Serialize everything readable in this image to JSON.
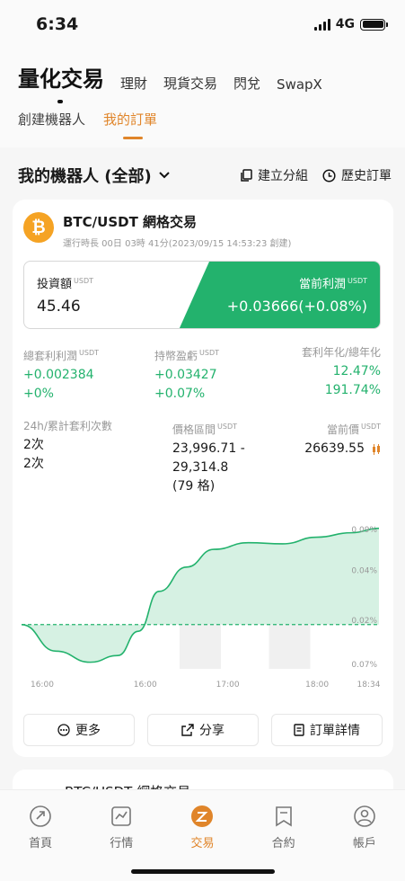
{
  "status": {
    "time": "6:34",
    "network": "4G"
  },
  "header": {
    "tabs": [
      "量化交易",
      "理財",
      "現貨交易",
      "閃兌",
      "SwapX"
    ],
    "sub_tabs": [
      "創建機器人",
      "我的訂單"
    ]
  },
  "section": {
    "title": "我的機器人 (全部)",
    "group_action": "建立分組",
    "history_action": "歷史訂單"
  },
  "bot": {
    "coin_icon": "bitcoin-icon",
    "pair": "BTC/USDT 網格交易",
    "runtime": "運行時長 00日 03時 41分(2023/09/15 14:53:23 創建)",
    "invest_label": "投資額",
    "invest_unit": "USDT",
    "invest_value": "45.46",
    "profit_label": "當前利潤",
    "profit_unit": "USDT",
    "profit_value": "+0.03666(+0.08%)",
    "stats": {
      "total_arb_label": "總套利利潤",
      "total_arb_unit": "USDT",
      "total_arb_value": "+0.002384",
      "total_arb_pct": "+0%",
      "holding_label": "持幣盈虧",
      "holding_unit": "USDT",
      "holding_value": "+0.03427",
      "holding_pct": "+0.07%",
      "annual_label": "套利年化/總年化",
      "annual_arb": "12.47%",
      "annual_total": "191.74%",
      "count_label": "24h/累計套利次數",
      "count_24h": "2次",
      "count_total": "2次",
      "range_label": "價格區間",
      "range_unit": "USDT",
      "range_low": "23,996.71 -",
      "range_high": "29,314.8",
      "range_grids": "(79 格)",
      "price_label": "當前價",
      "price_unit": "USDT",
      "price_value": "26639.55"
    },
    "buttons": {
      "more": "更多",
      "share": "分享",
      "details": "訂單詳情"
    }
  },
  "next_card": {
    "title": "BTC/USDT 網格交易"
  },
  "nav": {
    "items": [
      {
        "label": "首頁",
        "icon": "home-icon"
      },
      {
        "label": "行情",
        "icon": "market-icon"
      },
      {
        "label": "交易",
        "icon": "trade-icon"
      },
      {
        "label": "合約",
        "icon": "contract-icon"
      },
      {
        "label": "帳戶",
        "icon": "account-icon"
      }
    ],
    "active_color": "#e0852a"
  },
  "colors": {
    "accent": "#e0852a",
    "profit": "#23b26d",
    "coin": "#f5a324"
  },
  "chart_data": {
    "type": "area",
    "x_tick_labels": [
      "16:00",
      "16:00",
      "17:00",
      "18:00",
      "18:34"
    ],
    "y_tick_labels": [
      "0.09%",
      "0.04%",
      "0.02%",
      "0.07%"
    ],
    "baseline": 0.0,
    "series": [
      {
        "values": [
          {
            "x": 0,
            "y": 0
          },
          {
            "x": 0.5,
            "y": -0.024
          },
          {
            "x": 1,
            "y": -0.034
          },
          {
            "x": 1.4,
            "y": -0.028
          },
          {
            "x": 1.7,
            "y": -0.006
          },
          {
            "x": 2.0,
            "y": 0.03
          },
          {
            "x": 2.4,
            "y": 0.052
          },
          {
            "x": 2.8,
            "y": 0.068
          },
          {
            "x": 3.3,
            "y": 0.074
          },
          {
            "x": 3.8,
            "y": 0.073
          },
          {
            "x": 4.3,
            "y": 0.079
          },
          {
            "x": 4.8,
            "y": 0.083
          },
          {
            "x": 5.2,
            "y": 0.087
          }
        ]
      }
    ],
    "shaded_x_ranges": [
      [
        2.3,
        2.9
      ],
      [
        3.6,
        4.2
      ]
    ]
  }
}
